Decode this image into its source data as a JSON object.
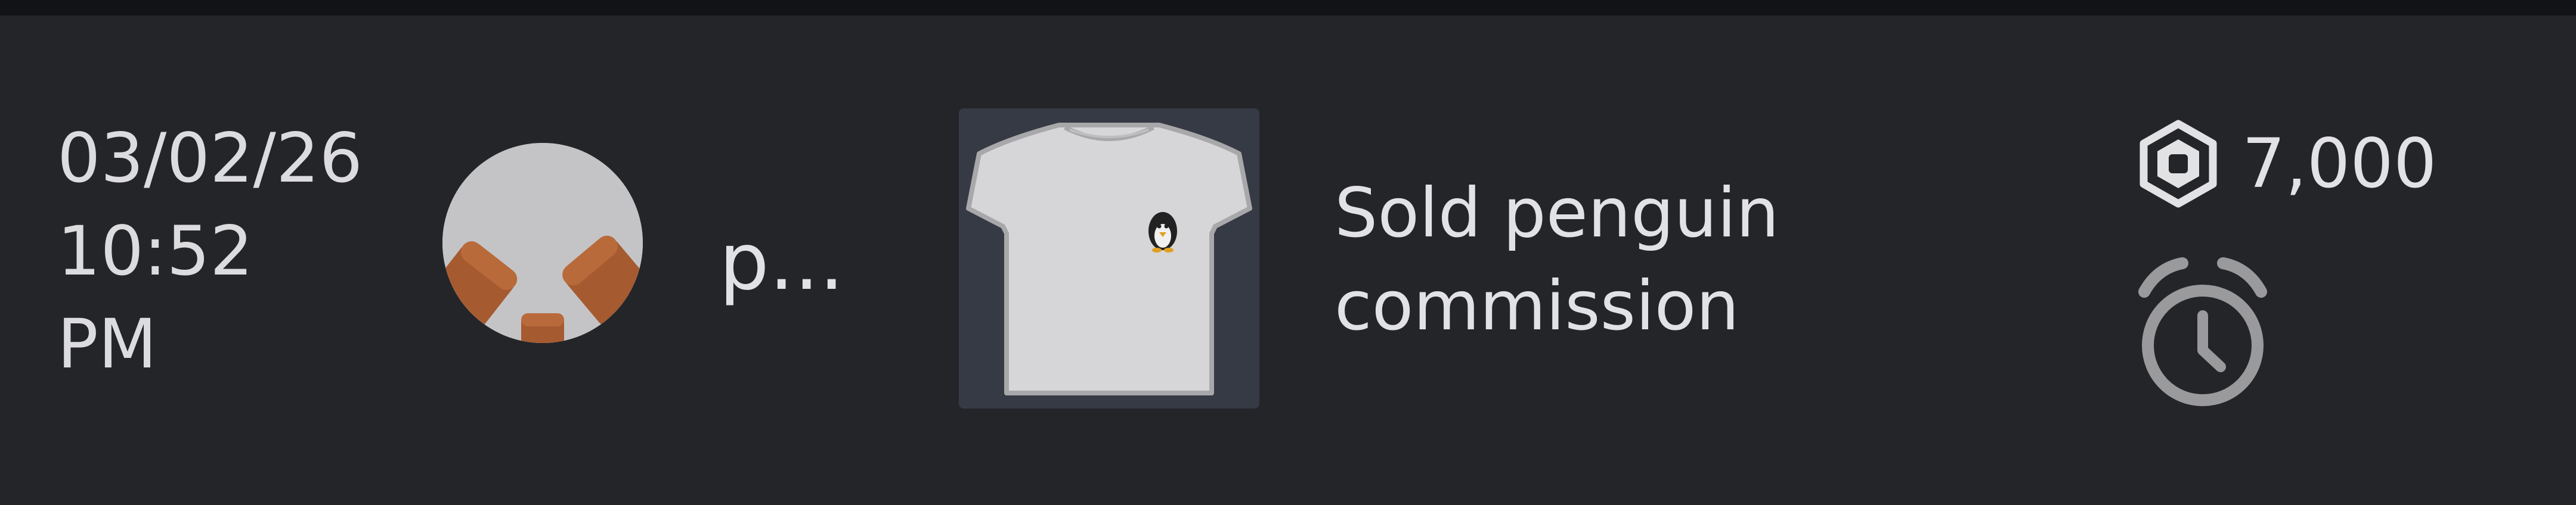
{
  "transaction": {
    "date": "03/02/26",
    "time": "10:52",
    "meridiem": "PM",
    "user": {
      "name": "p...",
      "avatar_icon": "avatar-headshot"
    },
    "item": {
      "icon": "t-shirt-penguin",
      "description": "Sold penguin commission"
    },
    "price": {
      "currency_icon": "robux-icon",
      "amount": "7,000"
    },
    "status_icon": "alarm-clock-icon"
  },
  "colors": {
    "background": "#232529",
    "top_strip": "#121316",
    "text": "#dcdcde",
    "thumb_background": "#363a45",
    "icon_gray": "#9a9a9c"
  }
}
